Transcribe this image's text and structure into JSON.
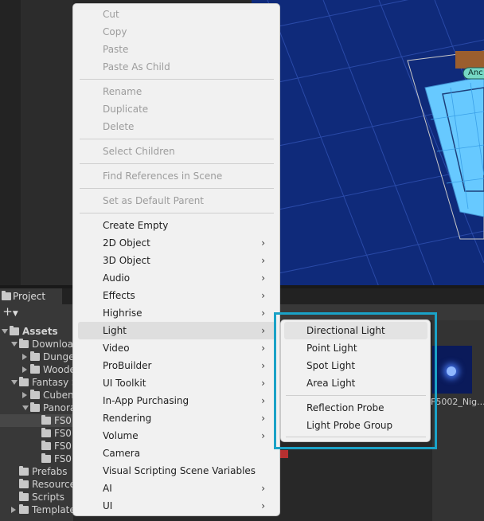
{
  "project_panel": {
    "tab_label": "Project",
    "add_button": "+",
    "tree": [
      {
        "label": "Assets",
        "bold": true
      },
      {
        "label": "Downloa"
      },
      {
        "label": "Dunge"
      },
      {
        "label": "Woode"
      },
      {
        "label": "Fantasy S"
      },
      {
        "label": "Cuben"
      },
      {
        "label": "Panora"
      },
      {
        "label": "FS0"
      },
      {
        "label": "FS0"
      },
      {
        "label": "FS0"
      },
      {
        "label": "FS0"
      },
      {
        "label": "Prefabs"
      },
      {
        "label": "Resource"
      },
      {
        "label": "Scripts"
      },
      {
        "label": "Template"
      }
    ],
    "asset_label": "F5002_Nig..."
  },
  "scene": {
    "anchor_label": "Anc"
  },
  "context_menu": {
    "items": [
      {
        "label": "Cut",
        "disabled": true
      },
      {
        "label": "Copy",
        "disabled": true
      },
      {
        "label": "Paste",
        "disabled": true
      },
      {
        "label": "Paste As Child",
        "disabled": true
      },
      {
        "label": "Rename",
        "disabled": true
      },
      {
        "label": "Duplicate",
        "disabled": true
      },
      {
        "label": "Delete",
        "disabled": true
      },
      {
        "label": "Select Children",
        "disabled": true
      },
      {
        "label": "Find References in Scene",
        "disabled": true
      },
      {
        "label": "Set as Default Parent",
        "disabled": true
      },
      {
        "label": "Create Empty"
      },
      {
        "label": "2D Object",
        "submenu": true
      },
      {
        "label": "3D Object",
        "submenu": true
      },
      {
        "label": "Audio",
        "submenu": true
      },
      {
        "label": "Effects",
        "submenu": true
      },
      {
        "label": "Highrise",
        "submenu": true
      },
      {
        "label": "Light",
        "submenu": true,
        "highlighted": true
      },
      {
        "label": "Video",
        "submenu": true
      },
      {
        "label": "ProBuilder",
        "submenu": true
      },
      {
        "label": "UI Toolkit",
        "submenu": true
      },
      {
        "label": "In-App Purchasing",
        "submenu": true
      },
      {
        "label": "Rendering",
        "submenu": true
      },
      {
        "label": "Volume",
        "submenu": true
      },
      {
        "label": "Camera"
      },
      {
        "label": "Visual Scripting Scene Variables"
      },
      {
        "label": "AI",
        "submenu": true
      },
      {
        "label": "UI",
        "submenu": true
      }
    ],
    "arrow_glyph": "›"
  },
  "light_submenu": {
    "items": [
      {
        "label": "Directional Light",
        "highlighted": true
      },
      {
        "label": "Point Light"
      },
      {
        "label": "Spot Light"
      },
      {
        "label": "Area Light"
      },
      {
        "label": "Reflection Probe"
      },
      {
        "label": "Light Probe Group"
      }
    ]
  },
  "colors": {
    "callout_border": "#1aa2c7",
    "scene_background": "#0f2a7a",
    "menu_background": "#f1f1f1"
  }
}
